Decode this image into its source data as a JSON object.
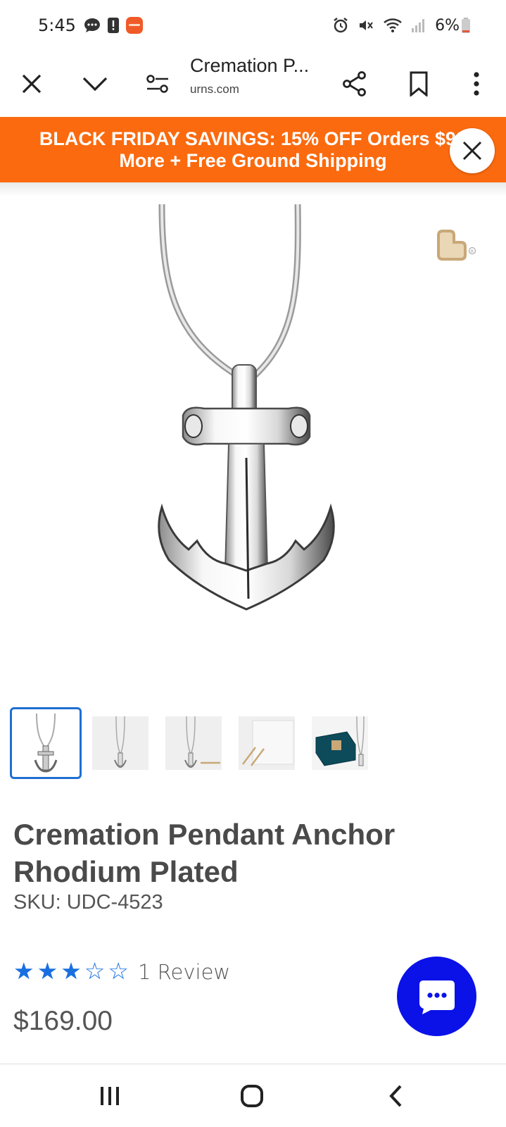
{
  "status_bar": {
    "time": "5:45",
    "battery": "6%"
  },
  "browser": {
    "page_title": "Cremation P...",
    "domain": "urns.com"
  },
  "promo": {
    "line1": "BLACK FRIDAY SAVINGS: 15% OFF Orders $99",
    "line2": "More + Free Ground Shipping",
    "color": "#fb6a0e"
  },
  "product": {
    "title": "Cremation Pendant Anchor Rhodium Plated",
    "sku_label": "SKU:",
    "sku": "UDC-4523",
    "rating": 3,
    "rating_max": 5,
    "review_count": "1 Review",
    "price": "$169.00",
    "thumbnail_count": 5,
    "selected_thumbnail": 1
  },
  "colors": {
    "accent": "#1a6fe0",
    "chat": "#0a12e8",
    "wishlist": "#c9a877"
  },
  "icons": {
    "toolbar": [
      "close-icon",
      "chevron-down-icon",
      "site-settings-icon",
      "share-icon",
      "bookmark-icon",
      "more-icon"
    ],
    "navigation": [
      "recent-apps-icon",
      "home-icon",
      "back-icon"
    ]
  }
}
